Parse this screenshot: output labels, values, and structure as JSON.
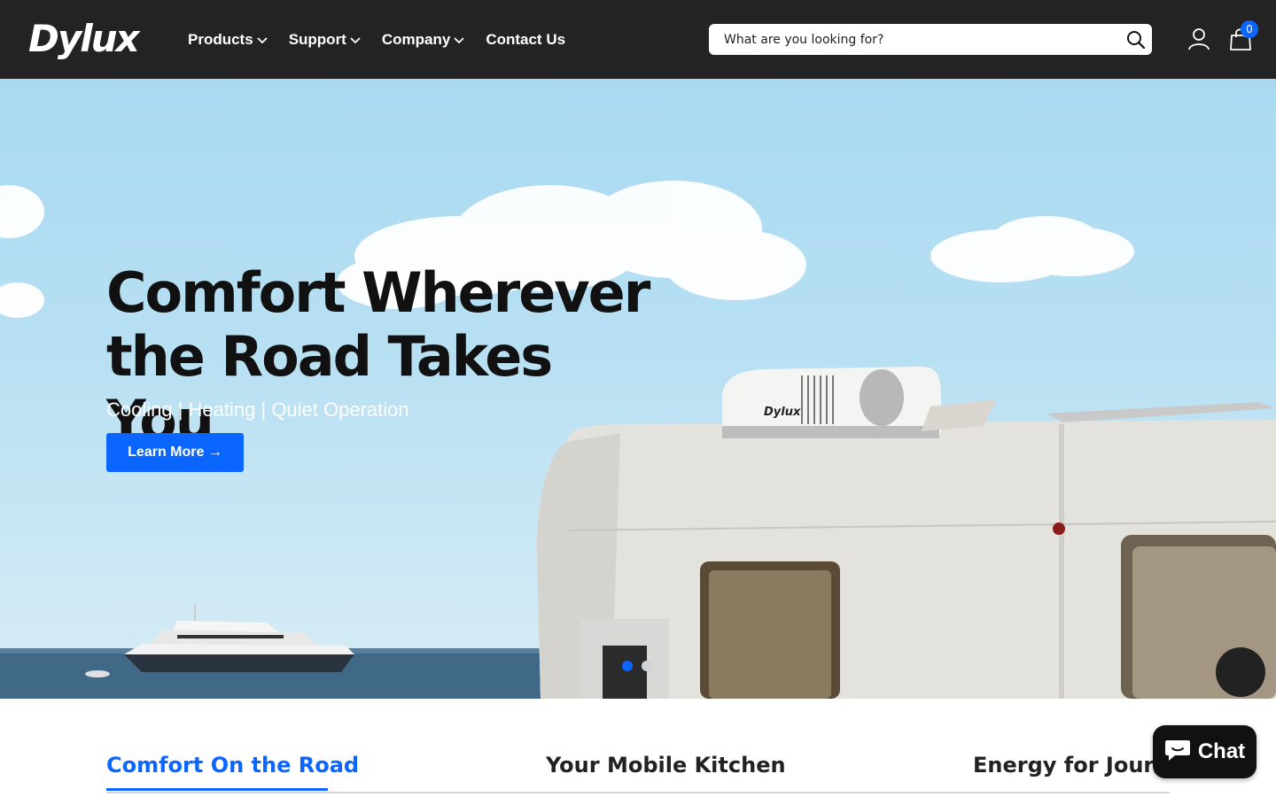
{
  "header": {
    "logo": "Dylux",
    "nav": [
      {
        "label": "Products",
        "has_dropdown": true
      },
      {
        "label": "Support",
        "has_dropdown": true
      },
      {
        "label": "Company",
        "has_dropdown": true
      },
      {
        "label": "Contact Us",
        "has_dropdown": false
      }
    ],
    "search": {
      "placeholder": "What are you looking for?",
      "icon": "search-icon"
    },
    "account_icon": "user-icon",
    "cart": {
      "icon": "shopping-bag-icon",
      "count": "0"
    }
  },
  "hero": {
    "title": "Comfort Wherever the Road Takes You",
    "subtitle": "Cooling | Heating | Quiet Operation",
    "button_label": "Learn More →",
    "slides": {
      "total": 2,
      "active": 1
    },
    "unit_brand_mark": "Dylux"
  },
  "tabs": [
    {
      "label": "Comfort On the Road",
      "active": true
    },
    {
      "label": "Your Mobile Kitchen",
      "active": false
    },
    {
      "label": "Energy for Journey",
      "active": false
    }
  ],
  "chat": {
    "label": "Chat",
    "icon": "chat-bubble-icon"
  },
  "colors": {
    "header_bg": "#232323",
    "accent": "#0a66ff",
    "text_dark": "#111111"
  }
}
